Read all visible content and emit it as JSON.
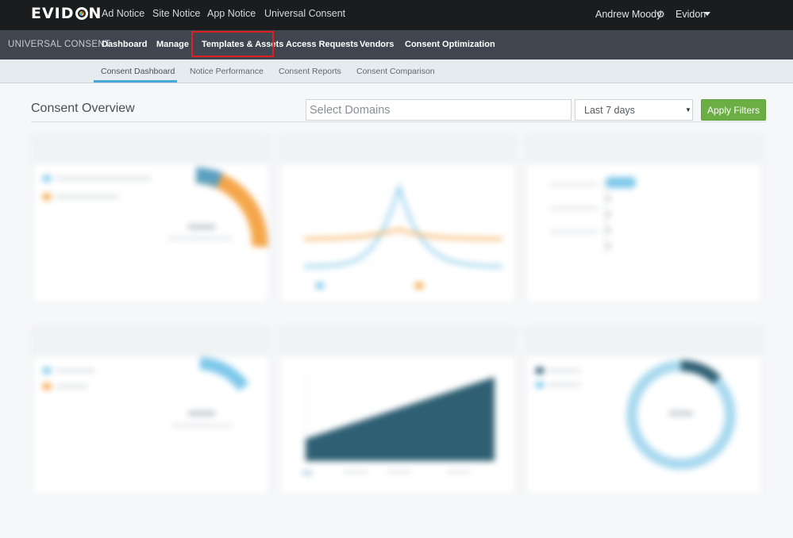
{
  "topbar": {
    "logo": "EVIDON",
    "nav": [
      "Ad Notice",
      "Site Notice",
      "App Notice",
      "Universal Consent"
    ],
    "user_name": "Andrew Moody",
    "account": "Evidon"
  },
  "secnav": {
    "product": "UNIVERSAL CONSENT",
    "items": [
      "Dashboard",
      "Manage",
      "Templates & Assets",
      "Access Requests",
      "Vendors",
      "Consent Optimization"
    ],
    "highlighted": "Templates & Assets"
  },
  "tabs": {
    "items": [
      "Consent Dashboard",
      "Notice Performance",
      "Consent Reports",
      "Consent Comparison"
    ],
    "active": "Consent Dashboard"
  },
  "main": {
    "title": "Consent Overview",
    "domain_placeholder": "Select Domains",
    "date_range": "Last 7 days",
    "apply_label": "Apply Filters"
  },
  "colors": {
    "accent": "#49a8d8",
    "apply": "#6aae44",
    "highlight_box": "#e02020",
    "orange": "#f5a64a",
    "teal_dark": "#2f5f73"
  }
}
